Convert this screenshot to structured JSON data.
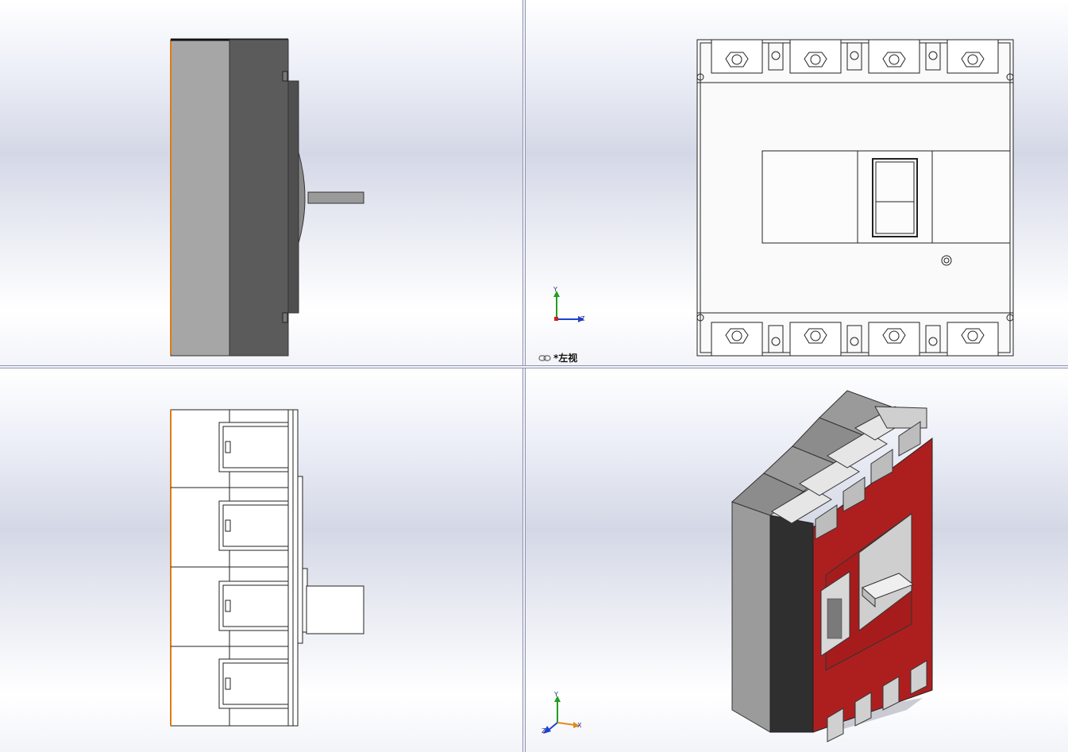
{
  "views": {
    "top_left": {
      "name": "right-view"
    },
    "top_right": {
      "name": "left-view",
      "label": "*左视",
      "label_icon": "link-icon"
    },
    "bottom_left": {
      "name": "top-view"
    },
    "bottom_right": {
      "name": "isometric-view"
    }
  },
  "axes": {
    "x": "X",
    "y": "Y",
    "z": "Z"
  },
  "colors": {
    "background_top": "#ffffff",
    "background_mid": "#d4d8e6",
    "red_face": "#b01e1e",
    "dark_gray": "#595959",
    "mid_gray": "#a6a6a6",
    "orange_edge": "#e07a10",
    "axis_x": "#d02020",
    "axis_y": "#20a020",
    "axis_z": "#2040d0"
  }
}
